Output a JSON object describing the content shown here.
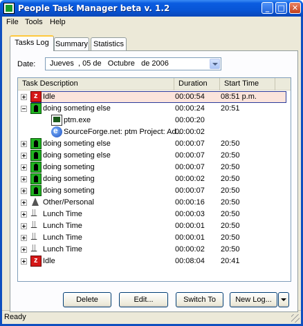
{
  "window": {
    "title": "People Task Manager  beta v. 1.2",
    "controls": {
      "minimize": "_",
      "maximize": "□",
      "close": "✕"
    }
  },
  "menu": {
    "items": [
      "File",
      "Tools",
      "Help"
    ]
  },
  "tabs": [
    {
      "label": "Tasks Log",
      "active": true
    },
    {
      "label": "Summary",
      "active": false
    },
    {
      "label": "Statistics",
      "active": false
    }
  ],
  "date": {
    "label": "Date:",
    "value": "Jueves  , 05 de   Octubre   de 2006"
  },
  "grid": {
    "columns": [
      "Task Description",
      "Duration",
      "Start Time"
    ],
    "rows": [
      {
        "level": 0,
        "expander": "plus",
        "icon": "idle",
        "desc": "Idle",
        "duration": "00:00:54",
        "start": "08:51 p.m.",
        "selected": true
      },
      {
        "level": 0,
        "expander": "minus",
        "icon": "work",
        "desc": "doing someting else",
        "duration": "00:00:24",
        "start": "20:51",
        "selected": false
      },
      {
        "level": 1,
        "expander": "",
        "icon": "exe",
        "desc": "ptm.exe",
        "duration": "00:00:20",
        "start": "",
        "selected": false
      },
      {
        "level": 1,
        "expander": "",
        "icon": "ie",
        "desc": "SourceForge.net: ptm Project: Ad...",
        "duration": "00:00:02",
        "start": "",
        "selected": false
      },
      {
        "level": 0,
        "expander": "plus",
        "icon": "work",
        "desc": "doing someting else",
        "duration": "00:00:07",
        "start": "20:50",
        "selected": false
      },
      {
        "level": 0,
        "expander": "plus",
        "icon": "work",
        "desc": "doing someting else",
        "duration": "00:00:07",
        "start": "20:50",
        "selected": false
      },
      {
        "level": 0,
        "expander": "plus",
        "icon": "work",
        "desc": "doing someting",
        "duration": "00:00:07",
        "start": "20:50",
        "selected": false
      },
      {
        "level": 0,
        "expander": "plus",
        "icon": "work",
        "desc": "doing someting",
        "duration": "00:00:02",
        "start": "20:50",
        "selected": false
      },
      {
        "level": 0,
        "expander": "plus",
        "icon": "work",
        "desc": "doing someting",
        "duration": "00:00:07",
        "start": "20:50",
        "selected": false
      },
      {
        "level": 0,
        "expander": "plus",
        "icon": "other",
        "desc": "Other/Personal",
        "duration": "00:00:16",
        "start": "20:50",
        "selected": false
      },
      {
        "level": 0,
        "expander": "plus",
        "icon": "lunch",
        "desc": "Lunch Time",
        "duration": "00:00:03",
        "start": "20:50",
        "selected": false
      },
      {
        "level": 0,
        "expander": "plus",
        "icon": "lunch",
        "desc": "Lunch Time",
        "duration": "00:00:01",
        "start": "20:50",
        "selected": false
      },
      {
        "level": 0,
        "expander": "plus",
        "icon": "lunch",
        "desc": "Lunch Time",
        "duration": "00:00:01",
        "start": "20:50",
        "selected": false
      },
      {
        "level": 0,
        "expander": "plus",
        "icon": "lunch",
        "desc": "Lunch Time",
        "duration": "00:00:02",
        "start": "20:50",
        "selected": false
      },
      {
        "level": 0,
        "expander": "plus",
        "icon": "idle",
        "desc": "Idle",
        "duration": "00:08:04",
        "start": "20:41",
        "selected": false
      }
    ]
  },
  "buttons": {
    "delete": "Delete",
    "edit": "Edit...",
    "switch": "Switch To",
    "new_log": "New Log..."
  },
  "status": {
    "text": "Ready"
  }
}
